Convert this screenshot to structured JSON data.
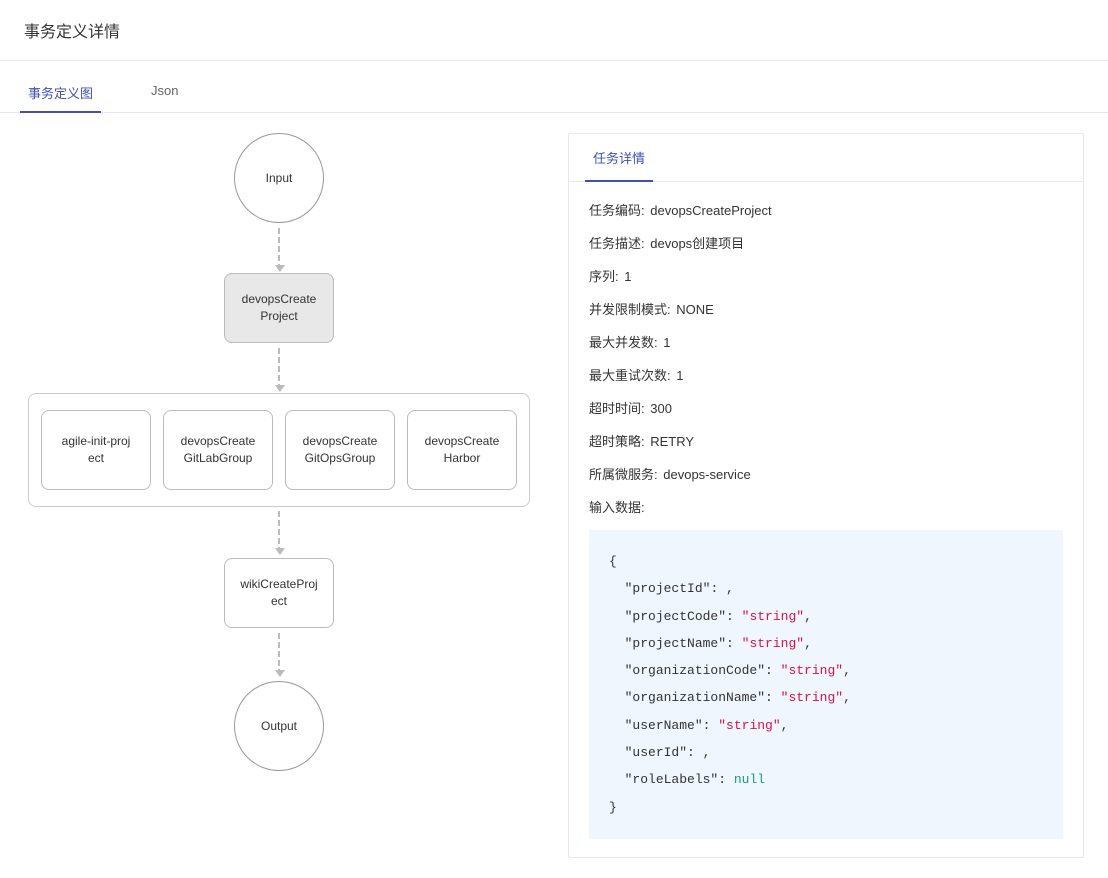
{
  "header": {
    "title": "事务定义详情"
  },
  "tabs": [
    {
      "label": "事务定义图",
      "active": true
    },
    {
      "label": "Json",
      "active": false
    }
  ],
  "diagram": {
    "input_label": "Input",
    "output_label": "Output",
    "selected_node": "devopsCreate\nProject",
    "group_nodes": [
      "agile-init-proj\nect",
      "devopsCreate\nGitLabGroup",
      "devopsCreate\nGitOpsGroup",
      "devopsCreate\nHarbor"
    ],
    "wiki_node": "wikiCreateProj\nect"
  },
  "detail": {
    "tab_label": "任务详情",
    "fields": {
      "code_label": "任务编码:",
      "code_value": "devopsCreateProject",
      "desc_label": "任务描述:",
      "desc_value": "devops创建项目",
      "seq_label": "序列:",
      "seq_value": "1",
      "limit_mode_label": "并发限制模式:",
      "limit_mode_value": "NONE",
      "max_conc_label": "最大并发数:",
      "max_conc_value": "1",
      "max_retry_label": "最大重试次数:",
      "max_retry_value": "1",
      "timeout_label": "超时时间:",
      "timeout_value": "300",
      "timeout_policy_label": "超时策略:",
      "timeout_policy_value": "RETRY",
      "service_label": "所属微服务:",
      "service_value": "devops-service",
      "input_data_label": "输入数据:"
    },
    "input_json": {
      "projectId": "",
      "projectCode": "string",
      "projectName": "string",
      "organizationCode": "string",
      "organizationName": "string",
      "userName": "string",
      "userId": "",
      "roleLabels": null
    }
  }
}
